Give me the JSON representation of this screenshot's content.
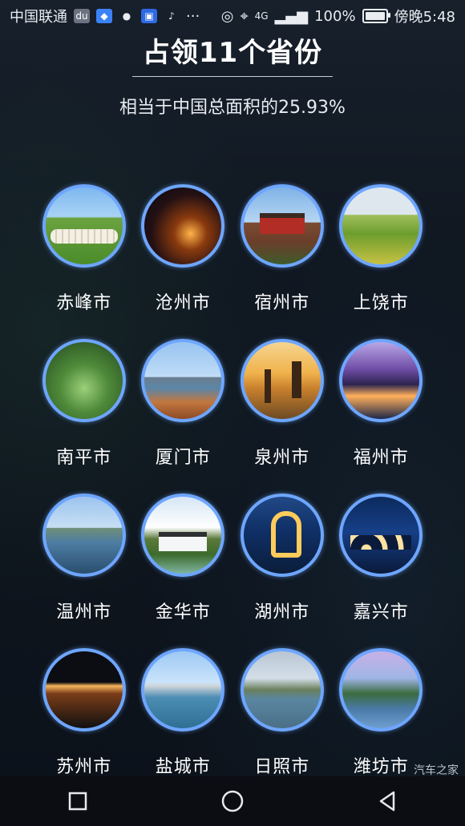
{
  "status_bar": {
    "carrier": "中国联通",
    "notification_icons": [
      "du-icon",
      "shield-app-icon",
      "wechat-icon",
      "autohome-app-icon",
      "tiktok-icon"
    ],
    "more": "···",
    "network": "4G",
    "battery_percent": "100%",
    "time": "傍晚5:48"
  },
  "header": {
    "title": "占领11个省份",
    "subtitle": "相当于中国总面积的25.93%"
  },
  "cities": [
    {
      "name": "赤峰市",
      "thumb": "t-grass"
    },
    {
      "name": "沧州市",
      "thumb": "t-night"
    },
    {
      "name": "宿州市",
      "thumb": "t-gate"
    },
    {
      "name": "上饶市",
      "thumb": "t-field"
    },
    {
      "name": "南平市",
      "thumb": "t-forest"
    },
    {
      "name": "厦门市",
      "thumb": "t-bay"
    },
    {
      "name": "泉州市",
      "thumb": "t-pagoda"
    },
    {
      "name": "福州市",
      "thumb": "t-fuzhou"
    },
    {
      "name": "温州市",
      "thumb": "t-lake"
    },
    {
      "name": "金华市",
      "thumb": "t-village"
    },
    {
      "name": "湖州市",
      "thumb": "t-horseshoe"
    },
    {
      "name": "嘉兴市",
      "thumb": "t-bridge"
    },
    {
      "name": "苏州市",
      "thumb": "t-suzhou"
    },
    {
      "name": "盐城市",
      "thumb": "t-yancheng"
    },
    {
      "name": "日照市",
      "thumb": "t-rizhao"
    },
    {
      "name": "潍坊市",
      "thumb": "t-weifang"
    }
  ],
  "watermark": "汽车之家",
  "nav": [
    "recent-apps-icon",
    "home-icon",
    "back-icon"
  ]
}
